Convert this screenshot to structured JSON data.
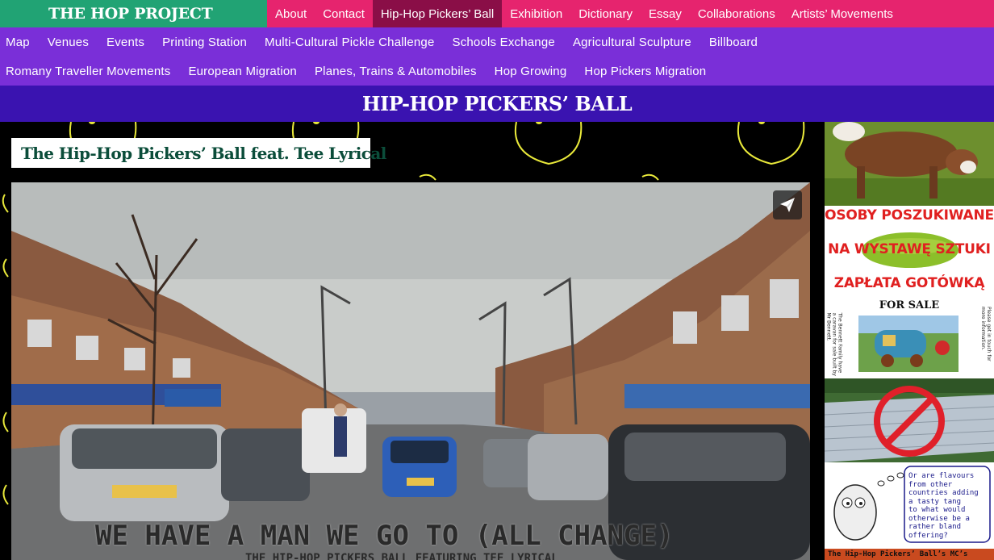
{
  "brand": {
    "name": "THE HOP PROJECT"
  },
  "primary_nav": [
    {
      "label": "About"
    },
    {
      "label": "Contact"
    },
    {
      "label": "Hip-Hop Pickers’ Ball",
      "active": true
    },
    {
      "label": "Exhibition"
    },
    {
      "label": "Dictionary"
    },
    {
      "label": "Essay"
    },
    {
      "label": "Collaborations"
    },
    {
      "label": "Artists’ Movements"
    }
  ],
  "secondary_nav": {
    "row1": [
      "Map",
      "Venues",
      "Events",
      "Printing Station",
      "Multi-Cultural Pickle Challenge",
      "Schools Exchange",
      "Agricultural Sculpture",
      "Billboard"
    ],
    "row2": [
      "Romany Traveller Movements",
      "European Migration",
      "Planes, Trains & Automobiles",
      "Hop Growing",
      "Hop Pickers Migration"
    ]
  },
  "page": {
    "title": "HIP-HOP PICKERS’ BALL"
  },
  "video": {
    "title": "The Hip-Hop Pickers’ Ball feat. Tee Lyrical",
    "caption": "WE HAVE A MAN WE GO TO (ALL CHANGE)",
    "caption_sub": "THE HIP-HOP PICKERS BALL FEATURING TEE LYRICAL",
    "share_icon": "paper-plane-icon"
  },
  "sidebar": {
    "poster": {
      "line1": "OSOBY POSZUKIWANE",
      "line2": "NA WYSTAWĘ SZTUKI",
      "line3": "ZAPŁATA GOTÓWKĄ",
      "for_sale": "FOR SALE",
      "side_left": "The Bennett Family have a caravan for sale built by Mr Bennett.",
      "side_right": "Please get in touch for more information."
    },
    "cartoon": {
      "bubble": "Or are flavours\nfrom other\ncountries adding\na tasty tang\nto what would\notherwise be a\nrather bland\noffering?",
      "footer": "The Hip-Hop Pickers’ Ball’s MC’s"
    }
  },
  "colors": {
    "brand_green": "#21a374",
    "nav_pink": "#e6246e",
    "nav_active": "#8a0e47",
    "secondary_purple": "#7a2fd8",
    "title_band": "#3a13b0",
    "doodle_yellow": "#e8e83a"
  }
}
